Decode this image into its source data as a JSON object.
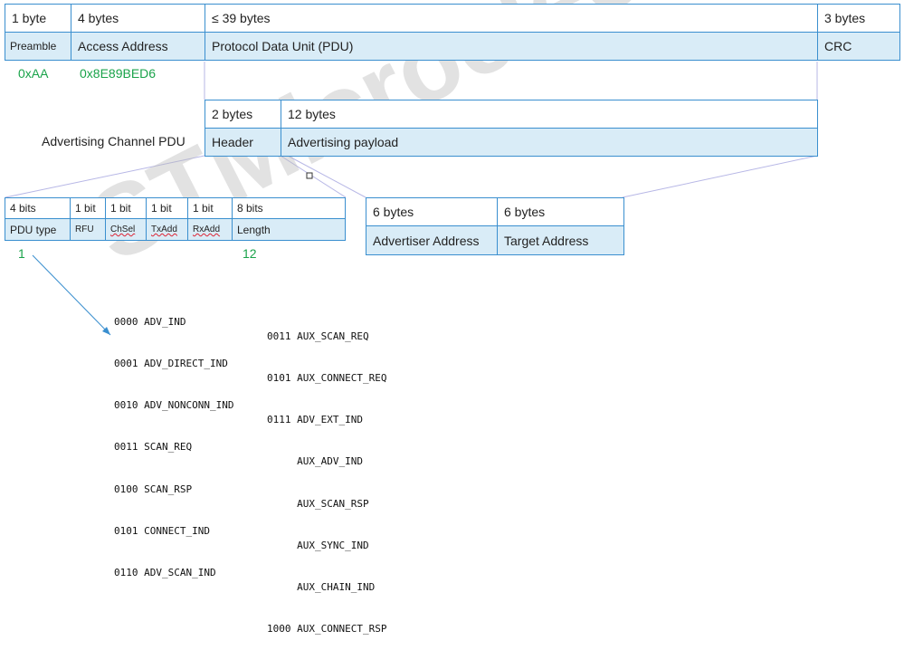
{
  "packet": {
    "sizes": [
      "1 byte",
      "4 bytes",
      "≤ 39 bytes",
      "3 bytes"
    ],
    "fields": [
      "Preamble",
      "Access Address",
      "Protocol Data Unit (PDU)",
      "CRC"
    ],
    "values": [
      "0xAA",
      "0x8E89BED6"
    ]
  },
  "pdu": {
    "label": "Advertising Channel PDU",
    "sizes": [
      "2 bytes",
      "12 bytes"
    ],
    "fields": [
      "Header",
      "Advertising payload"
    ]
  },
  "header": {
    "sizes": [
      "4 bits",
      "1 bit",
      "1 bit",
      "1 bit",
      "1 bit",
      "8 bits"
    ],
    "fields": [
      "PDU type",
      "RFU",
      "ChSel",
      "TxAdd",
      "RxAdd",
      "Length"
    ],
    "values": [
      "1",
      "12"
    ]
  },
  "payload": {
    "sizes": [
      "6 bytes",
      "6 bytes"
    ],
    "fields": [
      "Advertiser Address",
      "Target Address"
    ]
  },
  "pdu_types_left": [
    "0000 ADV_IND",
    "0001 ADV_DIRECT_IND",
    "0010 ADV_NONCONN_IND",
    "0011 SCAN_REQ",
    "0100 SCAN_RSP",
    "0101 CONNECT_IND",
    "0110 ADV_SCAN_IND"
  ],
  "pdu_types_right": [
    "0011 AUX_SCAN_REQ",
    "0101 AUX_CONNECT_REQ",
    "0111 ADV_EXT_IND",
    "     AUX_ADV_IND",
    "     AUX_SCAN_RSP",
    "     AUX_SYNC_IND",
    "     AUX_CHAIN_IND",
    "1000 AUX_CONNECT_RSP"
  ],
  "watermark": "STMicroelectronics",
  "colors": {
    "border": "#3a8fcf",
    "fill": "#d9ecf7",
    "value_green": "#1aa34a",
    "watermark": "#bbbbbb"
  }
}
